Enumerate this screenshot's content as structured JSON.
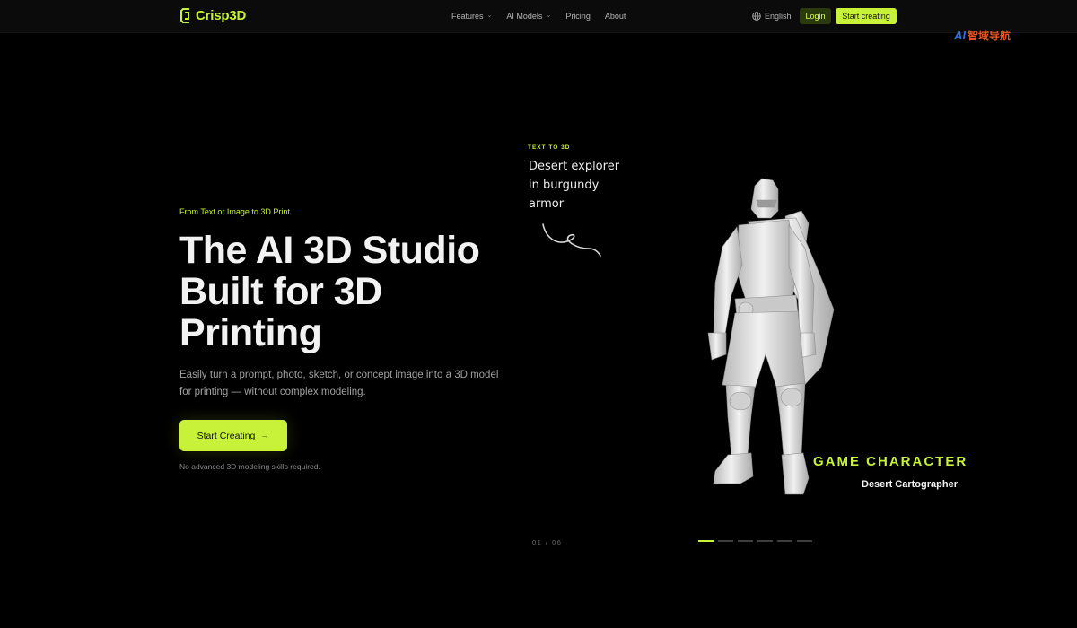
{
  "nav": {
    "brand": "Crisp3D",
    "links": [
      {
        "label": "Features",
        "has_dropdown": true
      },
      {
        "label": "AI Models",
        "has_dropdown": true
      },
      {
        "label": "Pricing",
        "has_dropdown": false
      },
      {
        "label": "About",
        "has_dropdown": false
      }
    ],
    "language": "English",
    "login_label": "Login",
    "start_label": "Start creating"
  },
  "watermark": {
    "ai": "AI",
    "cn": "智域导航"
  },
  "hero": {
    "eyebrow": "From Text or Image to 3D Print",
    "headline_lines": [
      "The AI 3D Studio",
      "Built for 3D",
      "Printing"
    ],
    "subtext": "Easily turn a prompt, photo, sketch, or concept image into a 3D model for printing — without complex modeling.",
    "cta_label": "Start Creating",
    "note": "No advanced 3D modeling skills required."
  },
  "showcase": {
    "mode_tag": "TEXT TO 3D",
    "prompt_lines": [
      "Desert explorer",
      "in burgundy",
      "armor"
    ],
    "category": "GAME CHARACTER",
    "title": "Desert Cartographer",
    "counter": "01 / 06",
    "slide_count": 6,
    "active_slide": 1
  },
  "colors": {
    "accent": "#c8f23a",
    "background": "#000000",
    "nav_bg": "#0b0b0b"
  }
}
